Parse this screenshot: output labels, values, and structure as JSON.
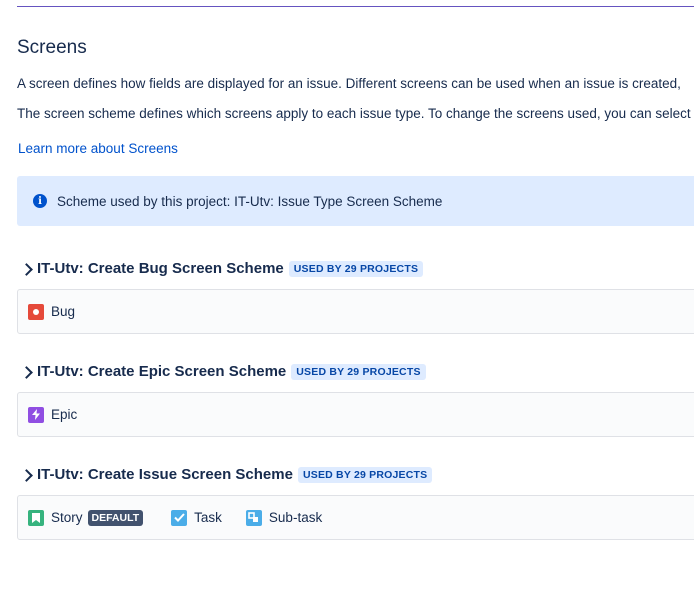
{
  "section": {
    "title": "Screens",
    "paragraph1": "A screen defines how fields are displayed for an issue. Different screens can be used when an issue is created,",
    "paragraph2": "The screen scheme defines which screens apply to each issue type. To change the screens used, you can select",
    "learn_more": "Learn more about Screens"
  },
  "info_banner": {
    "icon": "info-icon",
    "text": "Scheme used by this project: IT-Utv: Issue Type Screen Scheme"
  },
  "schemes": [
    {
      "title": "IT-Utv: Create Bug Screen Scheme",
      "usage": "USED BY 29 PROJECTS",
      "issue_types": [
        {
          "label": "Bug",
          "icon": "bug-icon"
        }
      ]
    },
    {
      "title": "IT-Utv: Create Epic Screen Scheme",
      "usage": "USED BY 29 PROJECTS",
      "issue_types": [
        {
          "label": "Epic",
          "icon": "epic-icon"
        }
      ]
    },
    {
      "title": "IT-Utv: Create Issue Screen Scheme",
      "usage": "USED BY 29 PROJECTS",
      "issue_types": [
        {
          "label": "Story",
          "icon": "story-icon",
          "badge": "DEFAULT"
        },
        {
          "label": "Task",
          "icon": "task-icon"
        },
        {
          "label": "Sub-task",
          "icon": "subtask-icon"
        }
      ]
    }
  ],
  "colors": {
    "accent_rule": "#6554c0",
    "link": "#0052cc",
    "banner_bg": "#deebff",
    "bug": "#e5493a",
    "epic": "#904ee2",
    "story": "#36b37e",
    "task": "#4bade8"
  }
}
